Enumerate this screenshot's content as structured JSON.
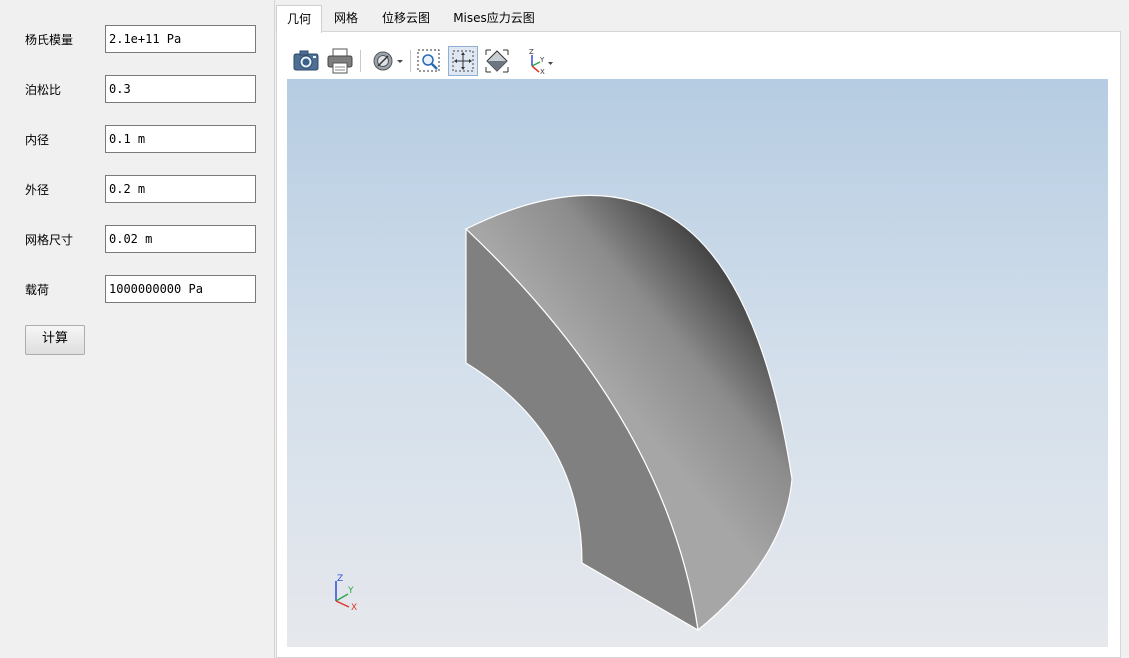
{
  "params": {
    "youngs_modulus": {
      "label": "杨氏模量",
      "value": "2.1e+11 Pa"
    },
    "poisson_ratio": {
      "label": "泊松比",
      "value": "0.3"
    },
    "inner_radius": {
      "label": "内径",
      "value": "0.1 m"
    },
    "outer_radius": {
      "label": "外径",
      "value": "0.2 m"
    },
    "mesh_size": {
      "label": "网格尺寸",
      "value": "0.02 m"
    },
    "load": {
      "label": "载荷",
      "value": "1000000000 Pa"
    }
  },
  "calc_button_label": "计算",
  "tabs": [
    {
      "label": "几何",
      "active": true
    },
    {
      "label": "网格",
      "active": false
    },
    {
      "label": "位移云图",
      "active": false
    },
    {
      "label": "Mises应力云图",
      "active": false
    }
  ],
  "toolbar": {
    "icons": [
      "camera-icon",
      "print-icon",
      "display-mode-icon",
      "zoom-box-icon",
      "fit-all-icon",
      "iso-view-icon",
      "axes-view-icon"
    ]
  },
  "triad": {
    "x_label": "X",
    "y_label": "Y",
    "z_label": "Z"
  },
  "colors": {
    "x_axis": "#e0332c",
    "y_axis": "#2aa84a",
    "z_axis": "#2b4fd8",
    "background_top": "#b6cce2",
    "background_bottom": "#e6e8ec"
  }
}
